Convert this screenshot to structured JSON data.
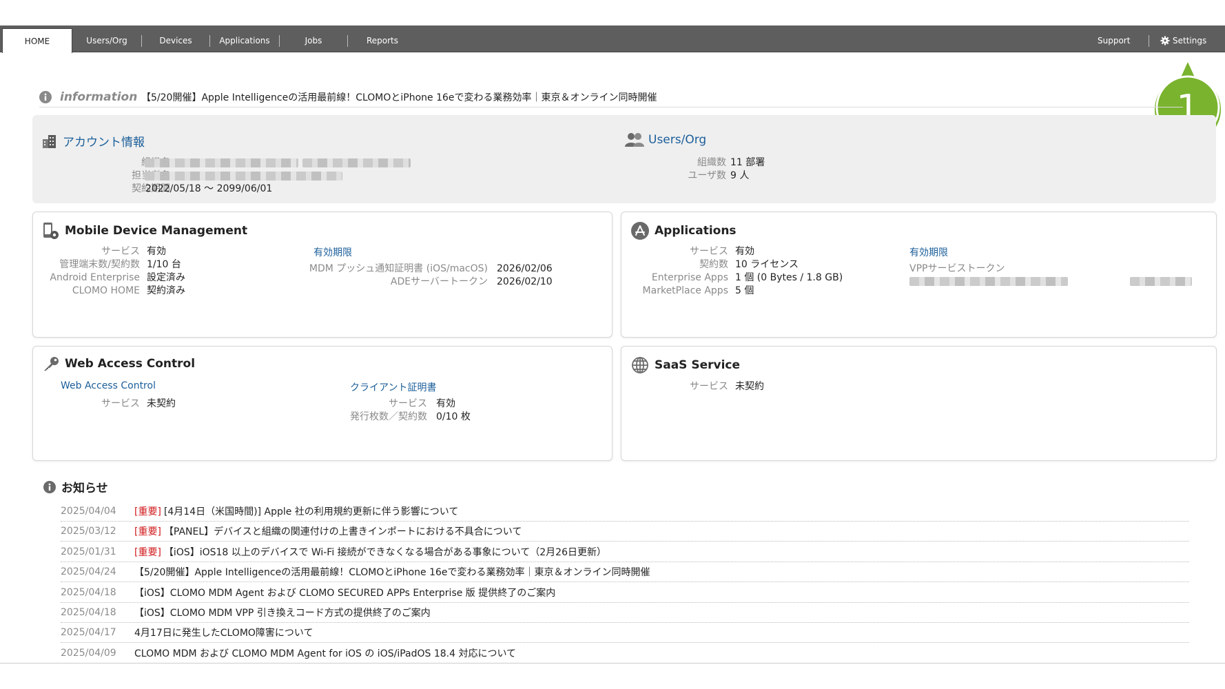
{
  "nav": {
    "tabs": [
      {
        "label": "HOME",
        "active": true
      },
      {
        "label": "Users/Org"
      },
      {
        "label": "Devices"
      },
      {
        "label": "Applications"
      },
      {
        "label": "Jobs"
      },
      {
        "label": "Reports"
      }
    ],
    "support": "Support",
    "settings": "Settings"
  },
  "callout": {
    "number": "1",
    "color": "#7ab32e"
  },
  "information": {
    "label": "information",
    "text": "【5/20開催】Apple Intelligenceの活用最前線！CLOMOとiPhone 16eで変わる業務効率｜東京＆オンライン同時開催"
  },
  "account": {
    "title": "アカウント情報",
    "org_name_label": "組織名",
    "owner_label": "担当者名",
    "contract_label": "契約期間",
    "contract_value": "2022/05/18 〜 2099/06/01"
  },
  "users_org": {
    "title": "Users/Org",
    "org_count_label": "組織数",
    "org_count_value": "11 部署",
    "user_count_label": "ユーザ数",
    "user_count_value": "9 人"
  },
  "mdm": {
    "title": "Mobile Device Management",
    "rows": [
      {
        "k": "サービス",
        "v": "有効"
      },
      {
        "k": "管理端末数/契約数",
        "v": "1/10 台"
      },
      {
        "k": "Android Enterprise",
        "v": "設定済み"
      },
      {
        "k": "CLOMO HOME",
        "v": "契約済み"
      }
    ],
    "expiry_title": "有効期限",
    "expiry_rows": [
      {
        "k": "MDM プッシュ通知証明書 (iOS/macOS)",
        "v": "2026/02/06"
      },
      {
        "k": "ADEサーバートークン",
        "v": "2026/02/10"
      }
    ]
  },
  "apps": {
    "title": "Applications",
    "rows": [
      {
        "k": "サービス",
        "v": "有効"
      },
      {
        "k": "契約数",
        "v": "10 ライセンス"
      },
      {
        "k": "Enterprise Apps",
        "v": "1 個 (0 Bytes / 1.8 GB)"
      },
      {
        "k": "MarketPlace Apps",
        "v": "5 個"
      }
    ],
    "expiry_title": "有効期限",
    "vpp_label": "VPPサービストークン"
  },
  "wac": {
    "title": "Web Access Control",
    "link": "Web Access Control",
    "service_label": "サービス",
    "service_value": "未契約",
    "cert_title": "クライアント証明書",
    "cert_service_label": "サービス",
    "cert_service_value": "有効",
    "cert_count_label": "発行枚数／契約数",
    "cert_count_value": "0/10 枚"
  },
  "saas": {
    "title": "SaaS Service",
    "service_label": "サービス",
    "service_value": "未契約"
  },
  "news": {
    "title": "お知らせ",
    "important_label": "[重要]",
    "items": [
      {
        "date": "2025/04/04",
        "important": true,
        "text": "[4月14日（米国時間)] Apple 社の利用規約更新に伴う影響について"
      },
      {
        "date": "2025/03/12",
        "important": true,
        "text": "【PANEL】デバイスと組織の関連付けの上書きインポートにおける不具合について"
      },
      {
        "date": "2025/01/31",
        "important": true,
        "text": "【iOS】iOS18 以上のデバイスで Wi-Fi 接続ができなくなる場合がある事象について（2月26日更新）"
      },
      {
        "date": "2025/04/24",
        "important": false,
        "text": "【5/20開催】Apple Intelligenceの活用最前線！CLOMOとiPhone 16eで変わる業務効率｜東京＆オンライン同時開催"
      },
      {
        "date": "2025/04/18",
        "important": false,
        "text": "【iOS】CLOMO MDM Agent および CLOMO SECURED APPs Enterprise 版 提供終了のご案内"
      },
      {
        "date": "2025/04/18",
        "important": false,
        "text": "【iOS】CLOMO MDM VPP 引き換えコード方式の提供終了のご案内"
      },
      {
        "date": "2025/04/17",
        "important": false,
        "text": "4月17日に発生したCLOMO障害について"
      },
      {
        "date": "2025/04/09",
        "important": false,
        "text": "CLOMO MDM および CLOMO MDM Agent for iOS の iOS/iPadOS 18.4 対応について"
      }
    ]
  }
}
